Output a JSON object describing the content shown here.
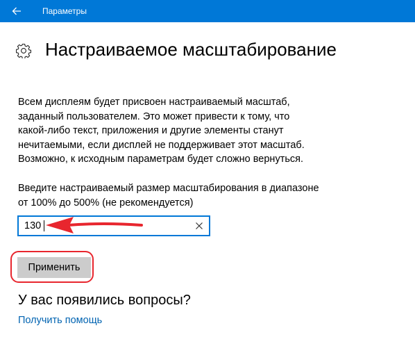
{
  "window": {
    "title": "Параметры"
  },
  "page": {
    "title": "Настраиваемое масштабирование"
  },
  "description": [
    "Всем дисплеям будет присвоен настраиваемый масштаб,",
    "заданный пользователем. Это может привести к тому, что",
    "какой-либо текст, приложения и другие элементы станут",
    "нечитаемыми, если дисплей не поддерживает этот масштаб.",
    "Возможно, к исходным параметрам будет сложно вернуться."
  ],
  "prompt": [
    "Введите настраиваемый размер масштабирования в диапазоне",
    "от 100%  до 500%  (не рекомендуется)"
  ],
  "scale_input": {
    "value": "130"
  },
  "apply_button": {
    "label": "Применить"
  },
  "questions": {
    "title": "У вас появились вопросы?",
    "help_link": "Получить помощь"
  },
  "colors": {
    "accent": "#0078d7",
    "annotation": "#e8262e",
    "link": "#0063b1",
    "button": "#cccccc"
  },
  "icons": {
    "back": "back-arrow-icon",
    "settings": "gear-icon",
    "clear": "clear-x-icon"
  }
}
